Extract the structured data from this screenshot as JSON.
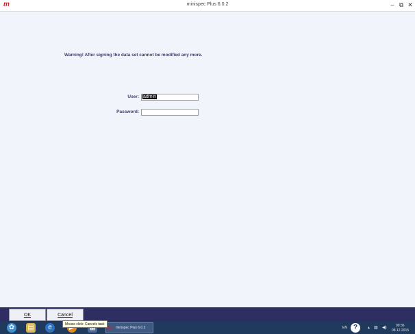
{
  "window": {
    "title": "minispec Plus 6.0.2",
    "logo": "m"
  },
  "controls": {
    "minimize": "–",
    "restore": "⧉",
    "close": "✕"
  },
  "form": {
    "warning": "Warning! After signing the data set cannot be modified any more.",
    "user_label": "User:",
    "user_value": "admin",
    "password_label": "Password:",
    "password_value": ""
  },
  "buttons": {
    "ok": "OK",
    "cancel": "Cancel"
  },
  "tooltip": "Mouse click: Cancels task",
  "taskbar": {
    "app_label": "minispec Plus 6.0.2",
    "language": "EN",
    "time": "09:36",
    "date": "08.12.2015"
  }
}
